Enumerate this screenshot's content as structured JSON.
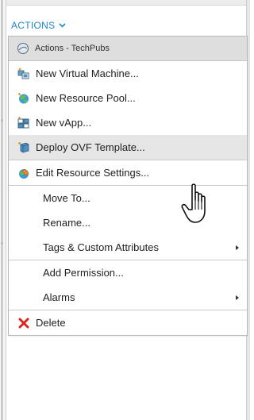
{
  "header": {
    "label": "ACTIONS"
  },
  "menu": {
    "title": "Actions - TechPubs",
    "groups": [
      {
        "items": [
          {
            "label": "New Virtual Machine...",
            "icon": "new-vm-icon"
          },
          {
            "label": "New Resource Pool...",
            "icon": "resource-pool-icon"
          },
          {
            "label": "New vApp...",
            "icon": "vapp-icon"
          },
          {
            "label": "Deploy OVF Template...",
            "icon": "ovf-template-icon",
            "hovered": true
          }
        ]
      },
      {
        "items": [
          {
            "label": "Edit Resource Settings...",
            "icon": "resource-settings-icon"
          }
        ]
      },
      {
        "items": [
          {
            "label": "Move To..."
          },
          {
            "label": "Rename..."
          },
          {
            "label": "Tags & Custom Attributes",
            "submenu": true
          }
        ]
      },
      {
        "items": [
          {
            "label": "Add Permission..."
          },
          {
            "label": "Alarms",
            "submenu": true
          }
        ]
      },
      {
        "items": [
          {
            "label": "Delete",
            "icon": "delete-icon"
          }
        ]
      }
    ]
  },
  "colors": {
    "accent": "#1e87c8",
    "hover": "#e6e6e6",
    "title_bg": "#dedede",
    "delete": "#d9261c"
  },
  "cursor": "hand-pointer-icon"
}
